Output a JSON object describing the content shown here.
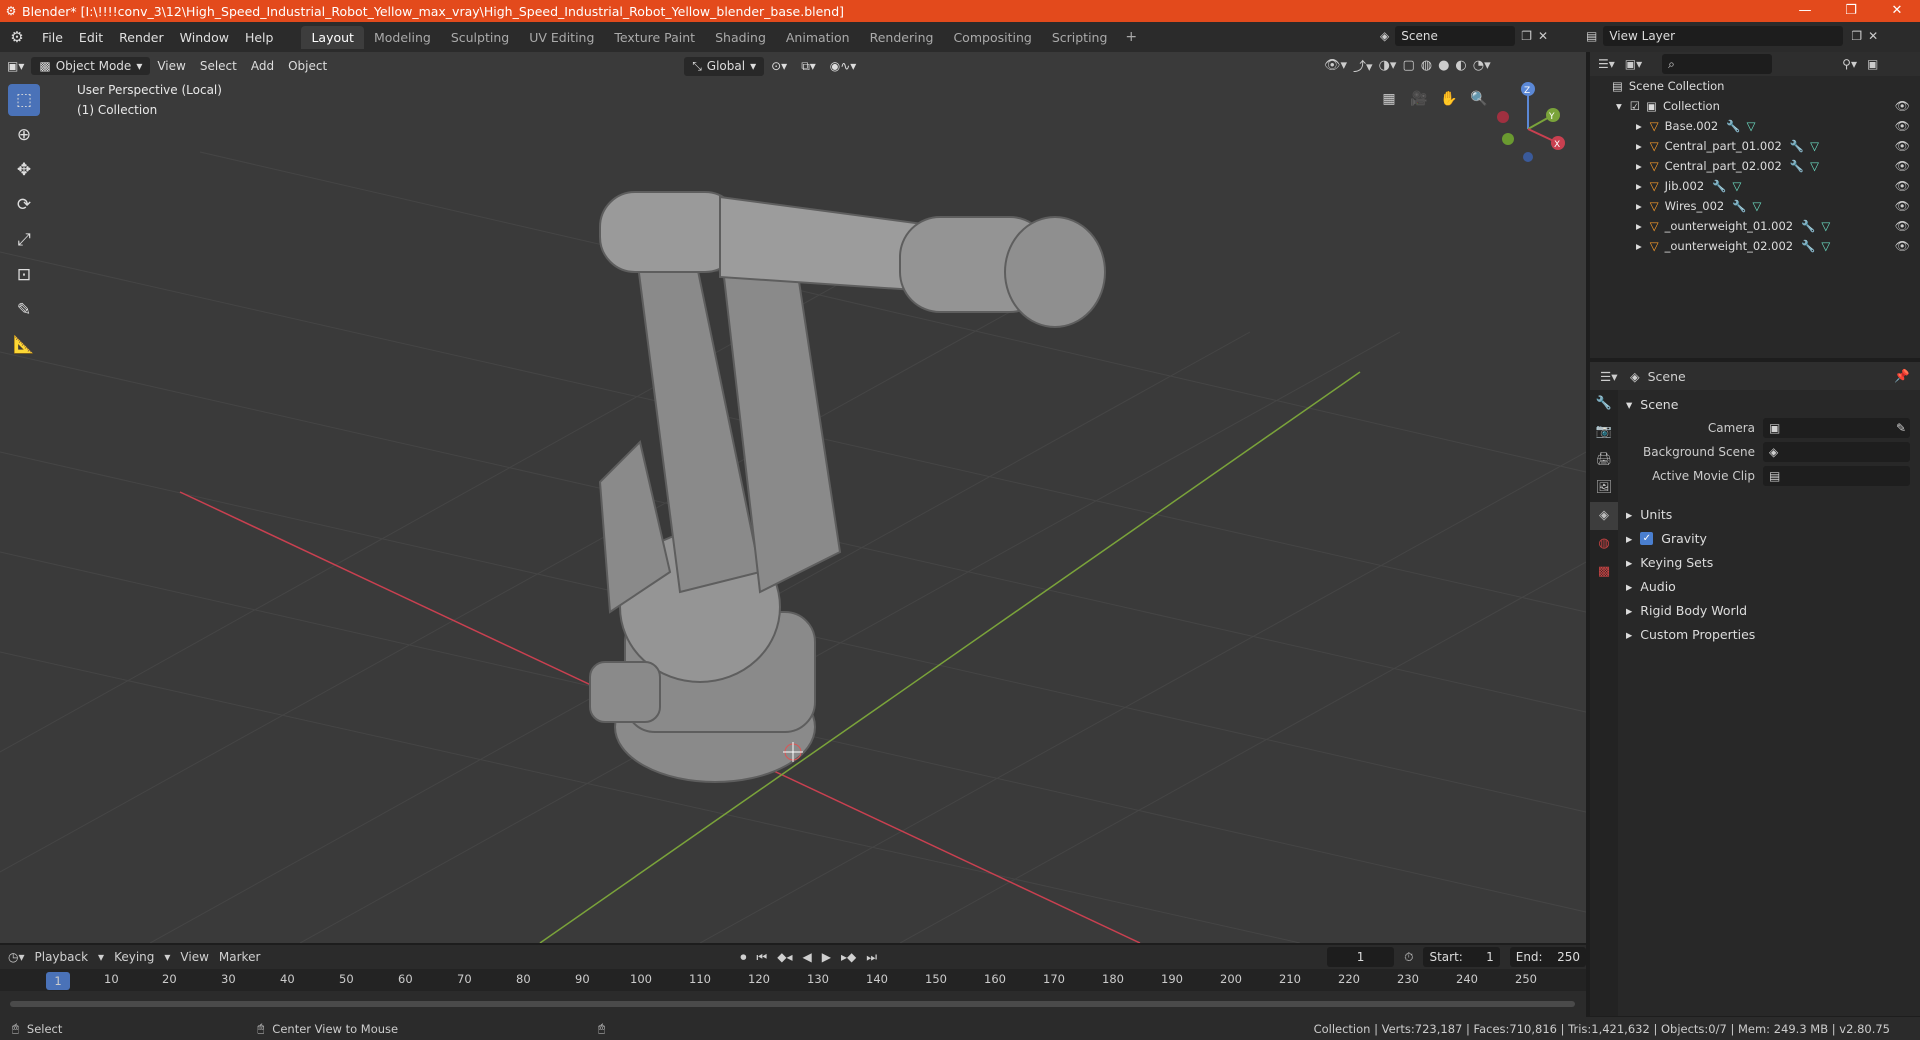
{
  "titlebar": {
    "title": "Blender* [I:\\!!!!conv_3\\12\\High_Speed_Industrial_Robot_Yellow_max_vray\\High_Speed_Industrial_Robot_Yellow_blender_base.blend]",
    "minimize": "—",
    "restore": "❐",
    "close": "✕"
  },
  "menu": [
    "File",
    "Edit",
    "Render",
    "Window",
    "Help"
  ],
  "workspaces": [
    "Layout",
    "Modeling",
    "Sculpting",
    "UV Editing",
    "Texture Paint",
    "Shading",
    "Animation",
    "Rendering",
    "Compositing",
    "Scripting"
  ],
  "active_workspace": "Layout",
  "scene_name": "Scene",
  "view_layer": "View Layer",
  "viewport": {
    "mode": "Object Mode",
    "menus": [
      "View",
      "Select",
      "Add",
      "Object"
    ],
    "transform": "Global",
    "perspective": "User Perspective (Local)",
    "collection": "(1) Collection",
    "axis_x": "X",
    "axis_y": "Y",
    "axis_z": "Z"
  },
  "outliner": {
    "root": "Scene Collection",
    "collection": "Collection",
    "items": [
      "Base.002",
      "Central_part_01.002",
      "Central_part_02.002",
      "Jib.002",
      "Wires_002",
      "_ounterweight_01.002",
      "_ounterweight_02.002"
    ]
  },
  "properties": {
    "header": "Scene",
    "section": "Scene",
    "camera_label": "Camera",
    "bg_label": "Background Scene",
    "clip_label": "Active Movie Clip",
    "subsections": [
      "Units",
      "Gravity",
      "Keying Sets",
      "Audio",
      "Rigid Body World",
      "Custom Properties"
    ]
  },
  "timeline": {
    "menus": [
      "Playback",
      "Keying",
      "View",
      "Marker"
    ],
    "current_frame": "1",
    "start_label": "Start:",
    "start": "1",
    "end_label": "End:",
    "end": "250",
    "ticks": [
      "10",
      "20",
      "30",
      "40",
      "50",
      "60",
      "70",
      "80",
      "90",
      "100",
      "110",
      "120",
      "130",
      "140",
      "150",
      "160",
      "170",
      "180",
      "190",
      "200",
      "210",
      "220",
      "230",
      "240",
      "250"
    ]
  },
  "status": {
    "left": "Select",
    "middle": "Center View to Mouse",
    "right": "Collection | Verts:723,187 | Faces:710,816 | Tris:1,421,632 | Objects:0/7 | Mem: 249.3 MB | v2.80.75"
  },
  "colors": {
    "accent": "#4a72b8",
    "title": "#e34a1c",
    "x_axis": "#c94050",
    "y_axis": "#7aa33a"
  }
}
